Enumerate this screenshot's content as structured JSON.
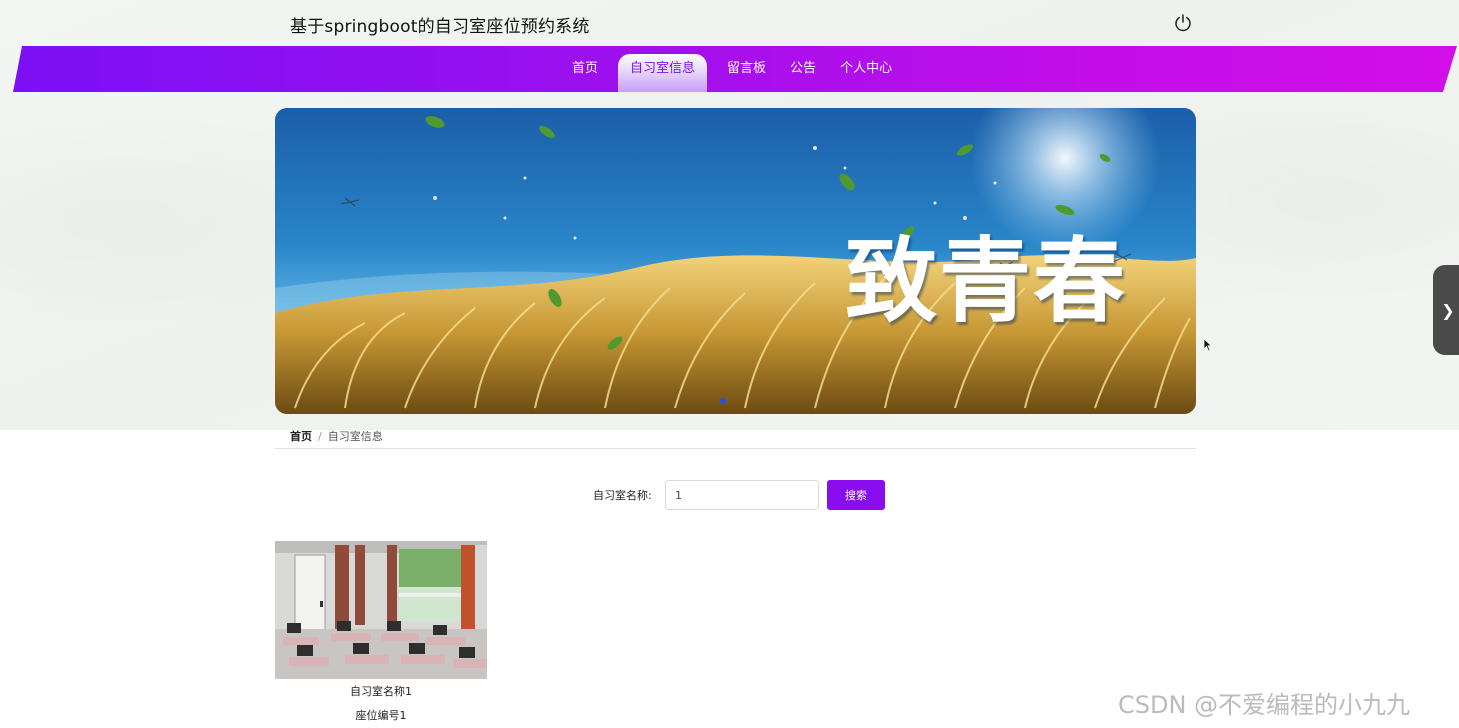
{
  "header": {
    "title": "基于springboot的自习室座位预约系统"
  },
  "nav": {
    "items": [
      {
        "label": "首页"
      },
      {
        "label": "自习室信息"
      },
      {
        "label": "留言板"
      },
      {
        "label": "公告"
      },
      {
        "label": "个人中心"
      }
    ],
    "active_index": 1
  },
  "banner": {
    "title": "致青春"
  },
  "breadcrumb": {
    "home": "首页",
    "separator": "/",
    "current": "自习室信息"
  },
  "search": {
    "label": "自习室名称:",
    "value": "1",
    "button_label": "搜索"
  },
  "rooms": [
    {
      "name": "自习室名称1",
      "seat": "座位编号1"
    }
  ],
  "watermark": "CSDN @不爱编程的小九九",
  "colors": {
    "nav_start": "#7c10f5",
    "nav_end": "#d20ee9",
    "button": "#8a0df0",
    "active_tab_text": "#7d12ea"
  },
  "icons": {
    "power": "power-icon",
    "next": "chevron-right-icon"
  }
}
